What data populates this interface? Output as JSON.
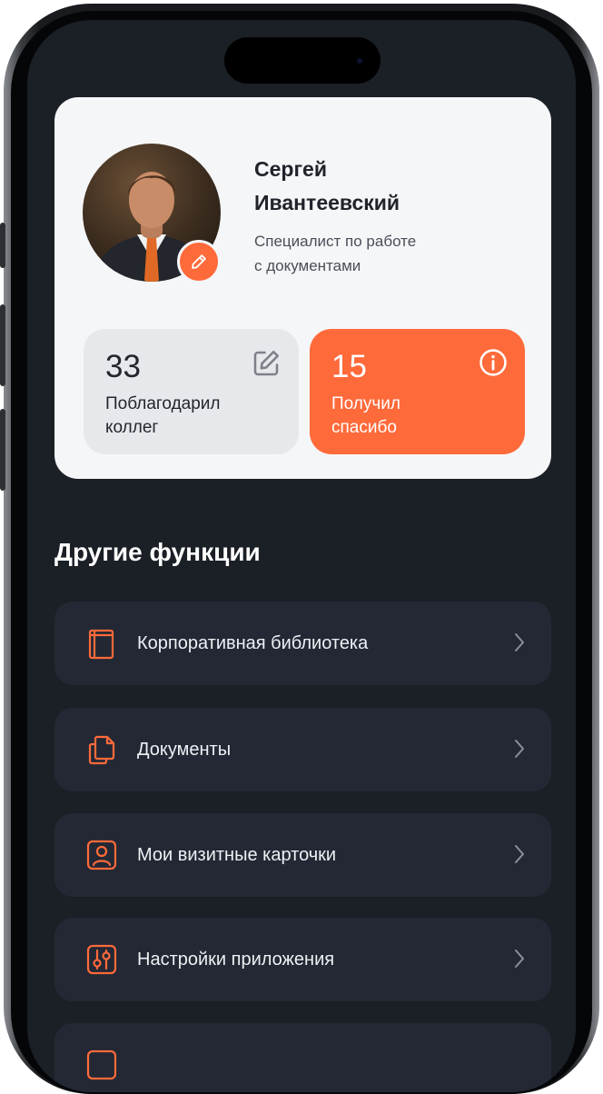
{
  "profile": {
    "first_name": "Сергей",
    "last_name": "Ивантеевский",
    "role_line1": "Специалист по работе",
    "role_line2": "с документами"
  },
  "stats": {
    "thanked_count": "33",
    "thanked_label_line1": "Поблагодарил",
    "thanked_label_line2": "коллег",
    "received_count": "15",
    "received_label_line1": "Получил",
    "received_label_line2": "спасибо"
  },
  "section": {
    "title": "Другие функции"
  },
  "menu": {
    "items": [
      {
        "label": "Корпоративная библиотека",
        "icon": "book-icon"
      },
      {
        "label": "Документы",
        "icon": "documents-icon"
      },
      {
        "label": "Мои визитные карточки",
        "icon": "contact-card-icon"
      },
      {
        "label": "Настройки приложения",
        "icon": "sliders-icon"
      }
    ]
  },
  "colors": {
    "accent": "#ff6a3a",
    "background": "#1b1f26",
    "card": "#f5f6f8",
    "menu_item": "#232834"
  }
}
